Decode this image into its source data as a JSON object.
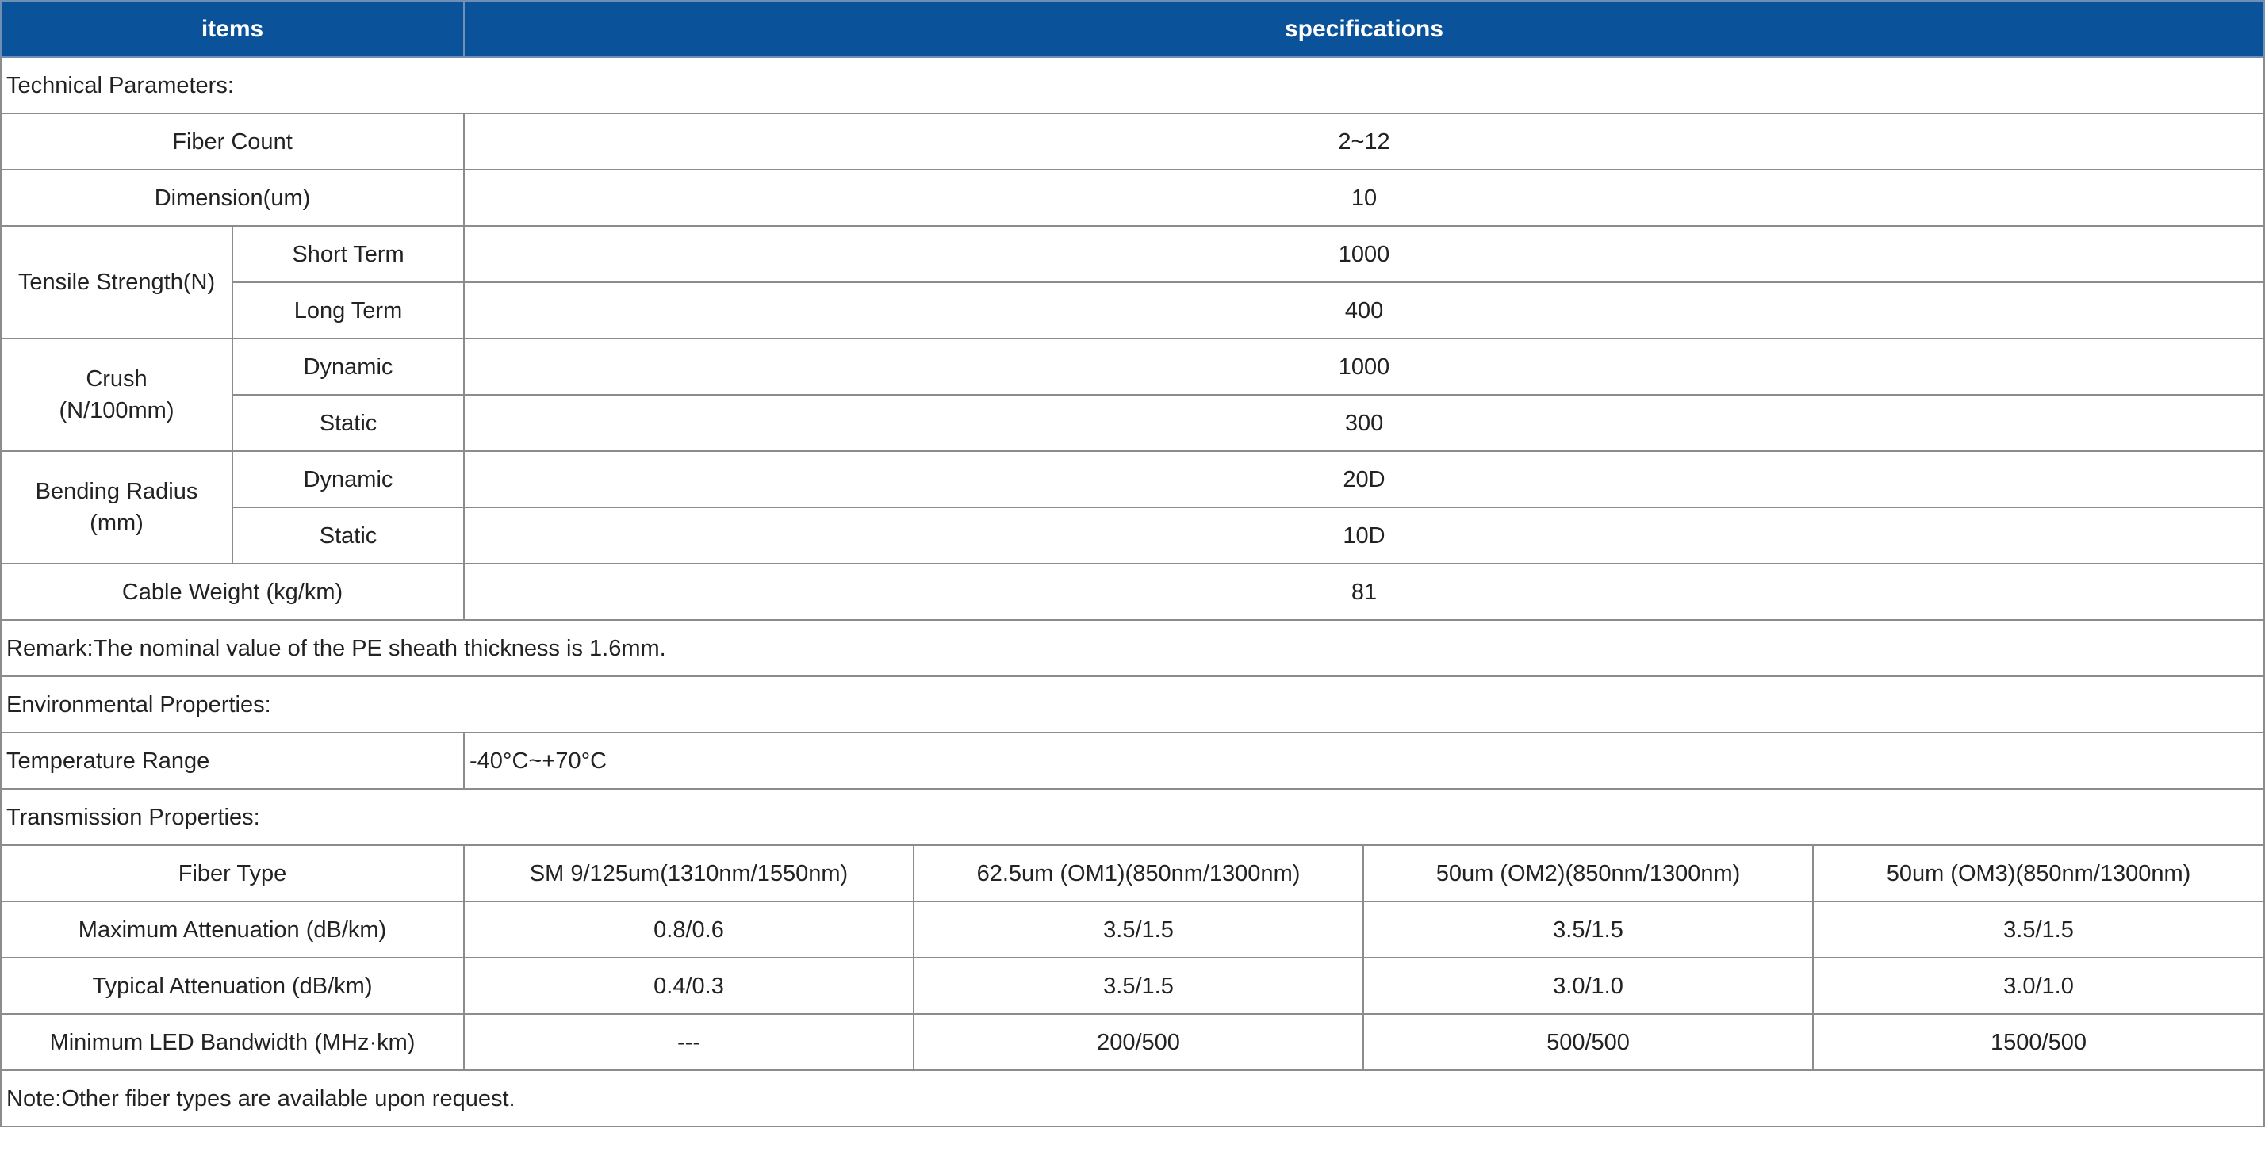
{
  "header": {
    "items": "items",
    "specifications": "specifications"
  },
  "technical": {
    "section_title": "Technical Parameters:",
    "fiber_count": {
      "label": "Fiber Count",
      "value": "2~12"
    },
    "dimension": {
      "label": "Dimension(um)",
      "value": "10"
    },
    "tensile": {
      "label": "Tensile Strength(N)",
      "short_label": "Short Term",
      "short_value": "1000",
      "long_label": "Long Term",
      "long_value": "400"
    },
    "crush": {
      "label_line1": "Crush",
      "label_line2": "(N/100mm)",
      "dynamic_label": "Dynamic",
      "dynamic_value": "1000",
      "static_label": "Static",
      "static_value": "300"
    },
    "bending": {
      "label_line1": "Bending Radius",
      "label_line2": "(mm)",
      "dynamic_label": "Dynamic",
      "dynamic_value": "20D",
      "static_label": "Static",
      "static_value": "10D"
    },
    "cable_weight": {
      "label": "Cable Weight (kg/km)",
      "value": "81"
    },
    "remark": "Remark:The nominal value of the PE sheath thickness is 1.6mm."
  },
  "environmental": {
    "section_title": "Environmental Properties:",
    "temperature": {
      "label": "Temperature Range",
      "value": "-40°C~+70°C"
    }
  },
  "transmission": {
    "section_title": "Transmission Properties:",
    "rows": [
      {
        "label": "Fiber Type",
        "values": [
          "SM 9/125um(1310nm/1550nm)",
          "62.5um (OM1)(850nm/1300nm)",
          "50um (OM2)(850nm/1300nm)",
          "50um (OM3)(850nm/1300nm)"
        ]
      },
      {
        "label": "Maximum Attenuation (dB/km)",
        "values": [
          "0.8/0.6",
          "3.5/1.5",
          "3.5/1.5",
          "3.5/1.5"
        ]
      },
      {
        "label": "Typical Attenuation (dB/km)",
        "values": [
          "0.4/0.3",
          "3.5/1.5",
          "3.0/1.0",
          "3.0/1.0"
        ]
      },
      {
        "label": "Minimum LED Bandwidth (MHz·km)",
        "values": [
          "---",
          "200/500",
          "500/500",
          "1500/500"
        ]
      }
    ],
    "note": "Note:Other fiber types are available upon request."
  }
}
